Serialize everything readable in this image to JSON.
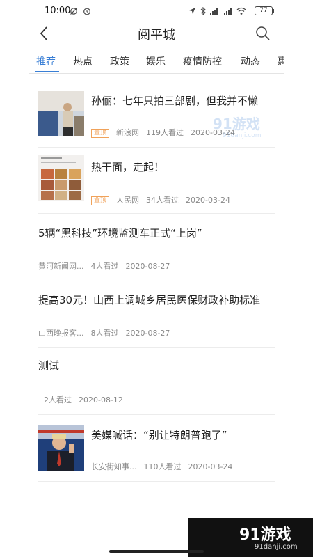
{
  "status_bar": {
    "time": "10:00",
    "left_icons": [
      "sync-off-icon",
      "alarm-icon"
    ],
    "right_icons": [
      "location-icon",
      "bluetooth-icon",
      "signal-icon",
      "signal-icon",
      "wifi-icon"
    ],
    "battery": "77"
  },
  "header": {
    "title": "阅平城",
    "back_icon": "chevron-left-icon",
    "search_icon": "search-icon"
  },
  "tabs": [
    {
      "label": "推荐",
      "active": true
    },
    {
      "label": "热点",
      "active": false
    },
    {
      "label": "政策",
      "active": false
    },
    {
      "label": "娱乐",
      "active": false
    },
    {
      "label": "疫情防控",
      "active": false
    },
    {
      "label": "动态",
      "active": false
    },
    {
      "label": "惠",
      "active": false
    }
  ],
  "accent_color": "#3a7fd5",
  "tag_color": "#f0a25a",
  "feed": [
    {
      "title": "孙俪：七年只拍三部剧，但我并不懒",
      "tag": "置顶",
      "source": "新浪网",
      "views": "119人看过",
      "date": "2020-03-24"
    },
    {
      "title": "热干面，走起！",
      "tag": "置顶",
      "source": "人民网",
      "views": "34人看过",
      "date": "2020-03-24"
    },
    {
      "title": "5辆“黑科技”环境监测车正式“上岗”",
      "source": "黄河新闻网...",
      "views": "4人看过",
      "date": "2020-08-27"
    },
    {
      "title": "提高30元！山西上调城乡居民医保财政补助标准",
      "source": "山西晚报客...",
      "views": "8人看过",
      "date": "2020-08-27"
    },
    {
      "title": "测试",
      "views": "2人看过",
      "date": "2020-08-12"
    },
    {
      "title": "美媒喊话：“别让特朗普跑了”",
      "source": "长安街知事...",
      "views": "110人看过",
      "date": "2020-03-24"
    }
  ],
  "watermark": {
    "text": "91游戏",
    "url": "91danji.com"
  },
  "brand_corner": {
    "text": "91游戏",
    "url": "91danji.com"
  }
}
